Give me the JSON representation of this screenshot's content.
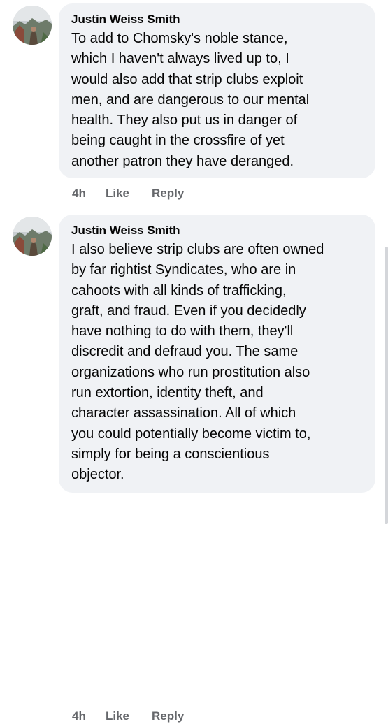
{
  "comments": [
    {
      "author": "Justin Weiss Smith",
      "text": "To add to Chomsky's noble stance,\nwhich I haven't always lived up to, I\nwould also add that strip clubs exploit\nmen, and are dangerous to our mental\nhealth. They also put us in danger of\nbeing caught in the crossfire of yet\nanother patron they have deranged.",
      "time": "4h",
      "like_label": "Like",
      "reply_label": "Reply",
      "avatar_icon": "profile-photo"
    },
    {
      "author": "Justin Weiss Smith",
      "text": "I also believe strip clubs are often owned\nby far rightist Syndicates, who are in\ncahoots with all kinds of trafficking,\ngraft, and fraud. Even if you decidedly\nhave nothing to do with them, they'll\ndiscredit and defraud you. The same\norganizations who run prostitution also\nrun extortion, identity theft, and\ncharacter assassination. All of which\nyou could potentially become victim to,\nsimply for being a conscientious\nobjector.",
      "time": "4h",
      "like_label": "Like",
      "reply_label": "Reply",
      "avatar_icon": "profile-photo"
    }
  ],
  "colors": {
    "bubble_bg": "#f0f2f5",
    "text": "#050505",
    "secondary_text": "#65676b"
  }
}
